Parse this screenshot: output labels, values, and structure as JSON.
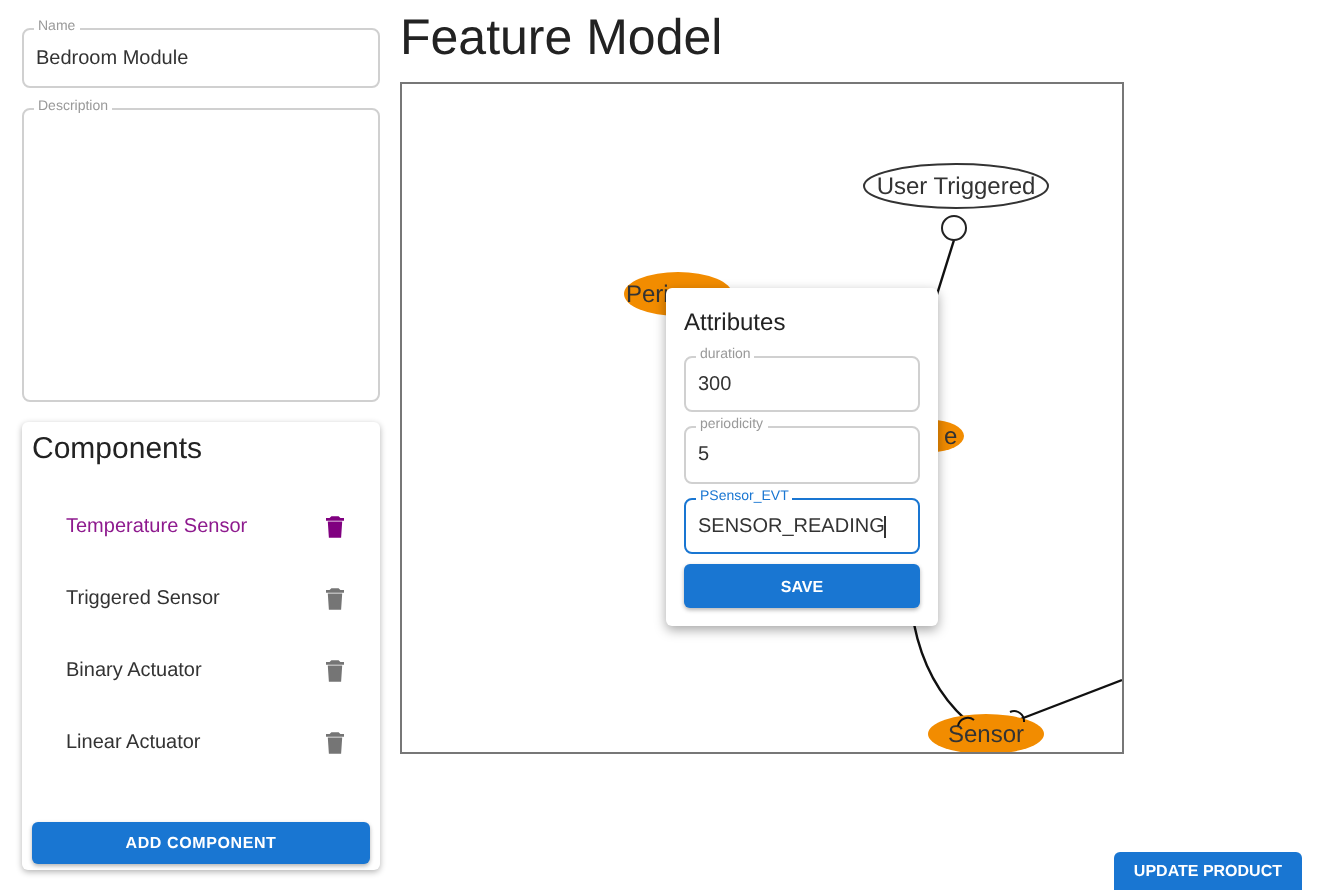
{
  "name_field": {
    "label": "Name",
    "value": "Bedroom Module"
  },
  "description_field": {
    "label": "Description"
  },
  "components": {
    "title": "Components",
    "items": [
      {
        "name": "Temperature Sensor",
        "selected": true
      },
      {
        "name": "Triggered Sensor",
        "selected": false
      },
      {
        "name": "Binary Actuator",
        "selected": false
      },
      {
        "name": "Linear Actuator",
        "selected": false
      }
    ],
    "add_button": "ADD COMPONENT"
  },
  "feature_model": {
    "title": "Feature Model",
    "nodes": [
      {
        "label": "User Triggered",
        "kind": "abstract"
      },
      {
        "label": "Peri",
        "kind": "concrete"
      },
      {
        "label": "e",
        "kind": "concrete"
      },
      {
        "label": "Sensor",
        "kind": "concrete"
      }
    ]
  },
  "attributes_popup": {
    "title": "Attributes",
    "fields": [
      {
        "label": "duration",
        "value": "300",
        "focused": false
      },
      {
        "label": "periodicity",
        "value": "5",
        "focused": false
      },
      {
        "label": "PSensor_EVT",
        "value": "SENSOR_READING",
        "focused": true
      }
    ],
    "save_button": "SAVE"
  },
  "update_button": "UPDATE PRODUCT"
}
